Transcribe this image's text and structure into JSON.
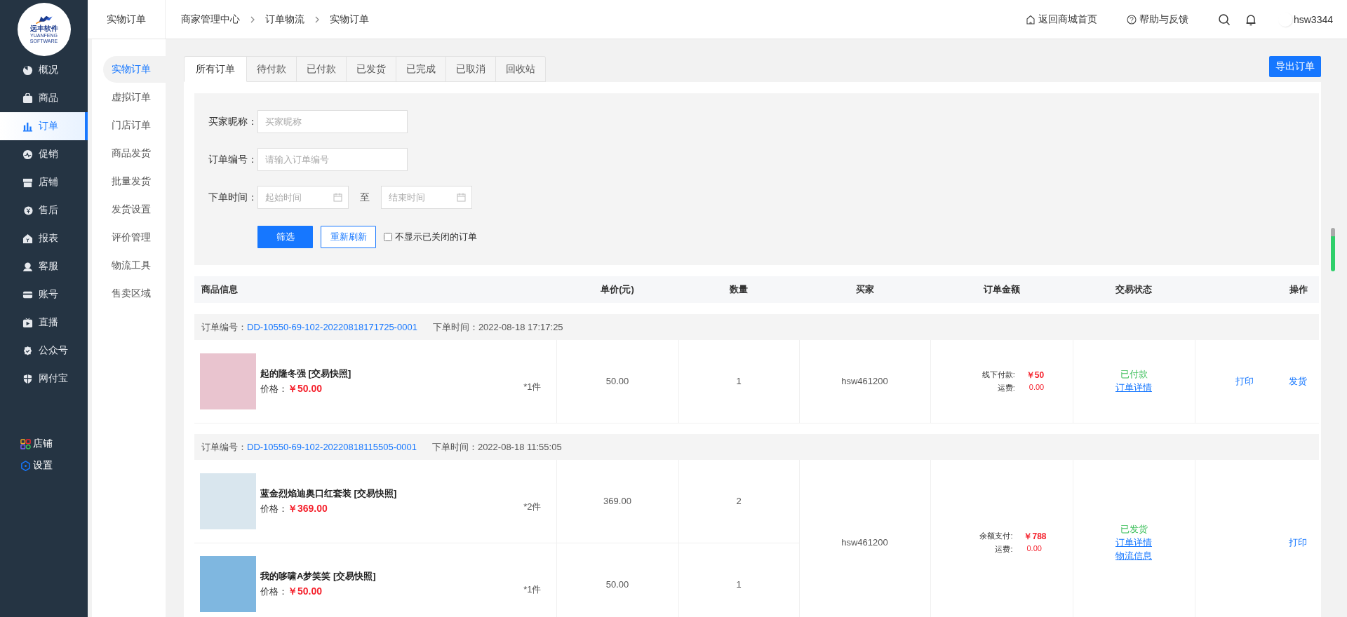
{
  "logo": {
    "name": "远丰软件",
    "subtitle": "YUANFENG SOFTWARE"
  },
  "nav": [
    {
      "label": "概况",
      "selected": false
    },
    {
      "label": "商品",
      "selected": false
    },
    {
      "label": "订单",
      "selected": true
    },
    {
      "label": "促销",
      "selected": false
    },
    {
      "label": "店铺",
      "selected": false
    },
    {
      "label": "售后",
      "selected": false
    },
    {
      "label": "报表",
      "selected": false
    },
    {
      "label": "客服",
      "selected": false
    },
    {
      "label": "账号",
      "selected": false
    },
    {
      "label": "直播",
      "selected": false
    },
    {
      "label": "公众号",
      "selected": false
    },
    {
      "label": "网付宝",
      "selected": false
    }
  ],
  "nav_footer": [
    {
      "label": "店铺",
      "kind": "apps"
    },
    {
      "label": "设置",
      "kind": "settings"
    }
  ],
  "section_title": "实物订单",
  "breadcrumb": [
    "商家管理中心",
    "订单物流",
    "实物订单"
  ],
  "header_links": [
    {
      "label": "返回商城首页",
      "kind": "home"
    },
    {
      "label": "帮助与反馈",
      "kind": "help"
    }
  ],
  "user": {
    "name": "hsw3344"
  },
  "subnav": [
    {
      "label": "实物订单",
      "selected": true
    },
    {
      "label": "虚拟订单",
      "selected": false
    },
    {
      "label": "门店订单",
      "selected": false
    },
    {
      "label": "商品发货",
      "selected": false
    },
    {
      "label": "批量发货",
      "selected": false
    },
    {
      "label": "发货设置",
      "selected": false
    },
    {
      "label": "评价管理",
      "selected": false
    },
    {
      "label": "物流工具",
      "selected": false
    },
    {
      "label": "售卖区域",
      "selected": false
    }
  ],
  "tabs": [
    {
      "label": "所有订单",
      "selected": true
    },
    {
      "label": "待付款",
      "selected": false
    },
    {
      "label": "已付款",
      "selected": false
    },
    {
      "label": "已发货",
      "selected": false
    },
    {
      "label": "已完成",
      "selected": false
    },
    {
      "label": "已取消",
      "selected": false
    },
    {
      "label": "回收站",
      "selected": false
    }
  ],
  "export_button": "导出订单",
  "filters": {
    "buyer": {
      "label": "买家昵称：",
      "placeholder": "买家昵称"
    },
    "order_no": {
      "label": "订单编号：",
      "placeholder": "请输入订单编号"
    },
    "date": {
      "label": "下单时间：",
      "start_placeholder": "起始时间",
      "separator": "至",
      "end_placeholder": "结束时间"
    },
    "buttons": [
      {
        "label": "筛选",
        "kind": "primary"
      },
      {
        "label": "重新刷新",
        "kind": "outline"
      }
    ],
    "hide_closed": {
      "label": "不显示已关闭的订单",
      "checked": false
    }
  },
  "table": {
    "columns": [
      "商品信息",
      "单价(元)",
      "数量",
      "买家",
      "订单金额",
      "交易状态",
      "操作"
    ],
    "orders": [
      {
        "order_no_label": "订单编号：",
        "order_no": "DD-10550-69-102-20220818171725-0001",
        "time_label": "下单时间：",
        "time": "2022-08-18 17:17:25",
        "items": [
          {
            "name": "起的隆冬强 [交易快照]",
            "price_label": "价格：",
            "price": "￥50.00",
            "count": "*1件",
            "unit_price": "50.00",
            "quantity": "1"
          }
        ],
        "buyer": "hsw461200",
        "pay_label": "线下付款:",
        "pay_amount": "￥50",
        "freight_label": "运费:",
        "freight": "0.00",
        "status": "已付款",
        "status_links": [
          "订单详情"
        ],
        "actions": [
          "打印",
          "发货"
        ]
      },
      {
        "order_no_label": "订单编号：",
        "order_no": "DD-10550-69-102-20220818115505-0001",
        "time_label": "下单时间：",
        "time": "2022-08-18 11:55:05",
        "items": [
          {
            "name": "蓝金烈焰迪奥口红套装 [交易快照]",
            "price_label": "价格：",
            "price": "￥369.00",
            "count": "*2件",
            "unit_price": "369.00",
            "quantity": "2"
          },
          {
            "name": "我的哆啸A梦笑笑 [交易快照]",
            "price_label": "价格：",
            "price": "￥50.00",
            "count": "*1件",
            "unit_price": "50.00",
            "quantity": "1"
          }
        ],
        "buyer": "hsw461200",
        "pay_label": "余额支付:",
        "pay_amount": "￥788",
        "freight_label": "运费:",
        "freight": "0.00",
        "status": "已发货",
        "status_links": [
          "订单详情",
          "物流信息"
        ],
        "actions": [
          "打印"
        ]
      }
    ]
  }
}
